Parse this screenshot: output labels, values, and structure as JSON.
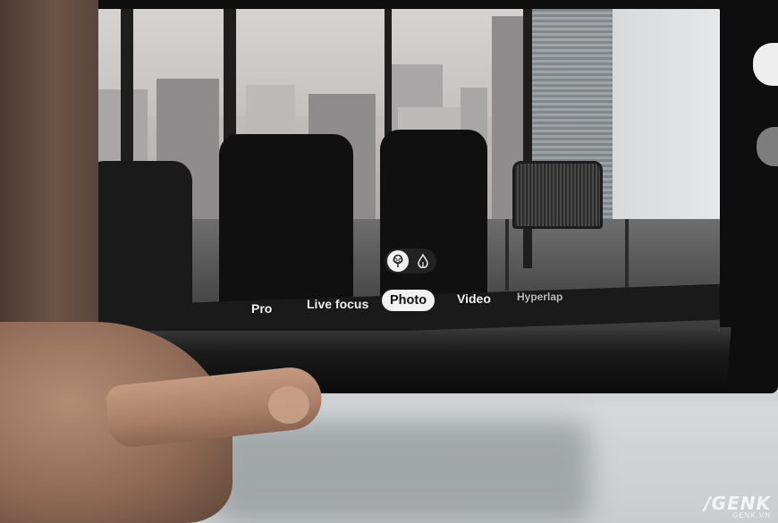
{
  "camera_modes": [
    {
      "label": "Pro",
      "state": "normal"
    },
    {
      "label": "Live focus",
      "state": "normal"
    },
    {
      "label": "Photo",
      "state": "selected"
    },
    {
      "label": "Video",
      "state": "normal"
    },
    {
      "label": "Hyperlap",
      "state": "dim"
    }
  ],
  "filters": [
    {
      "icon": "filter-tree-icon",
      "selected": true
    },
    {
      "icon": "filter-drop-icon",
      "selected": false
    }
  ],
  "watermark": {
    "main": "/GENK",
    "sub": "GENK.VN"
  },
  "colors": {
    "ui_text": "#f3f3f3",
    "selected_pill": "#f2f2f2"
  }
}
